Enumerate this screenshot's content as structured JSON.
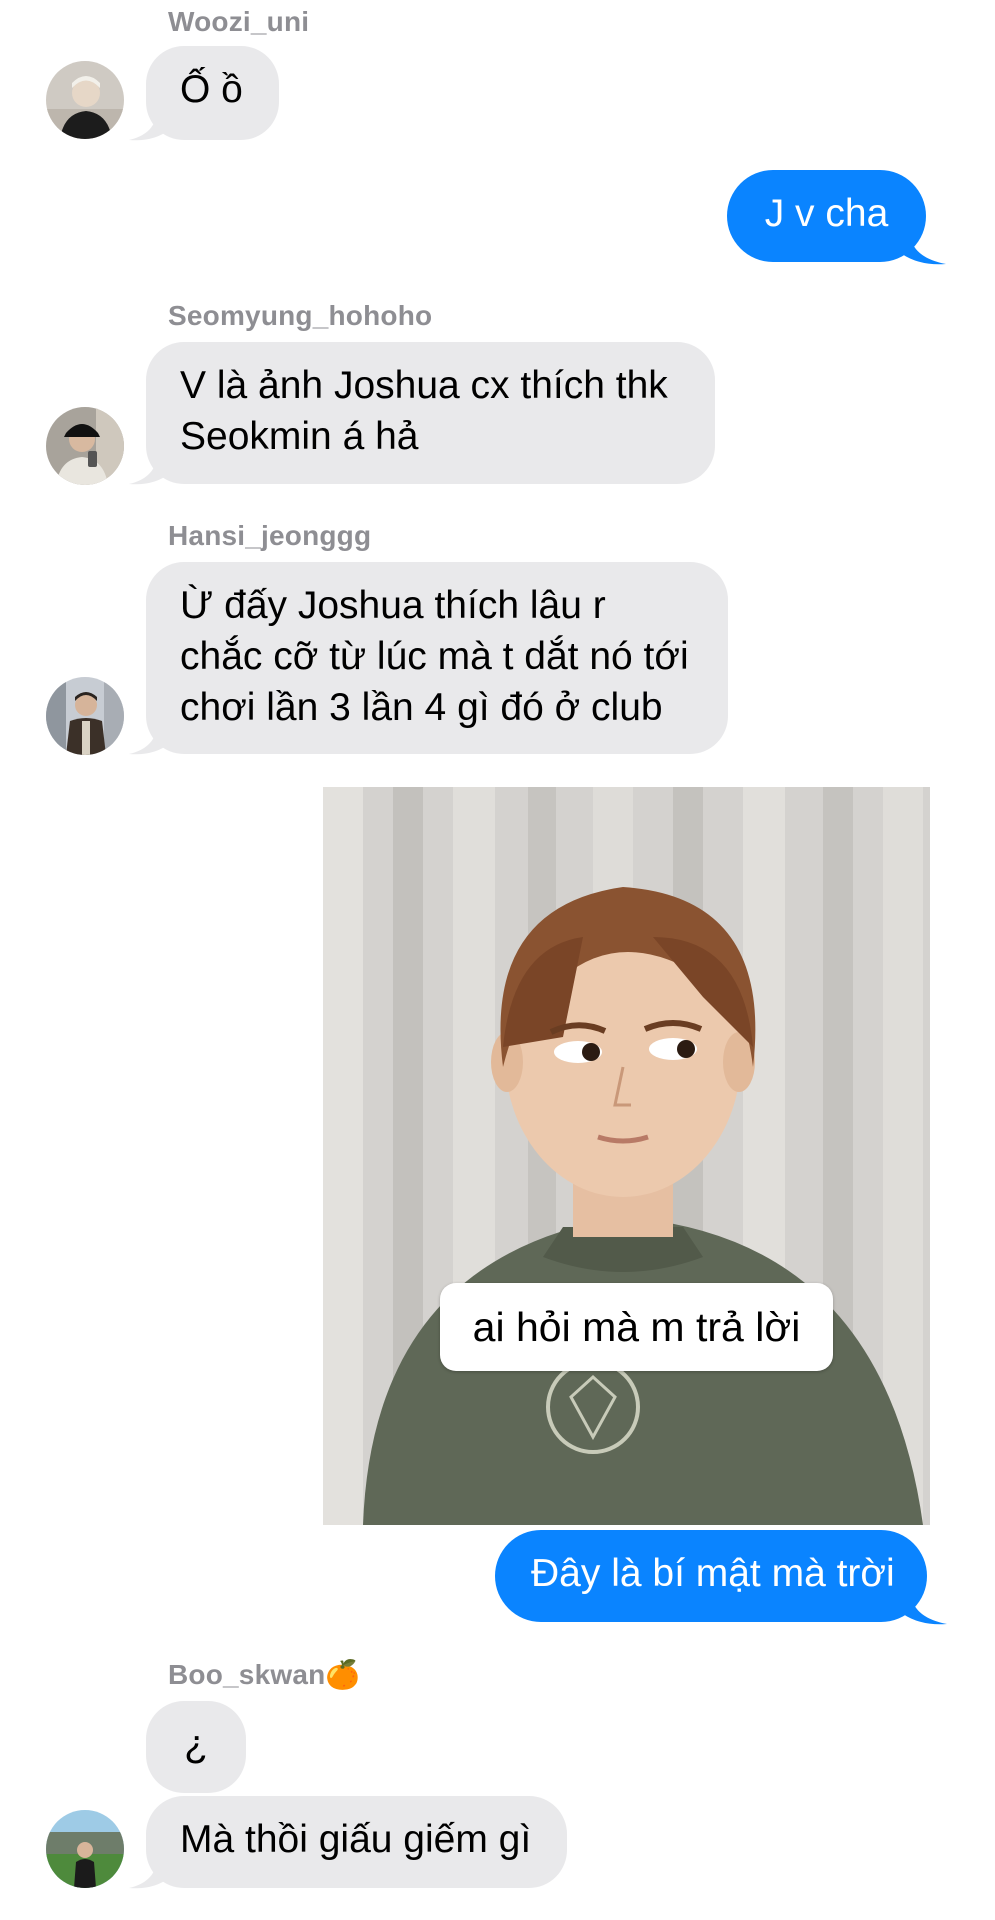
{
  "messages": {
    "woozi": {
      "sender": "Woozi_uni",
      "lines": [
        "Ố ồ"
      ]
    },
    "me_1": {
      "lines": [
        "J v cha"
      ]
    },
    "seomyung": {
      "sender": "Seomyung_hohoho",
      "lines": [
        "V là ảnh Joshua cx thích thk",
        "Seokmin á hả"
      ]
    },
    "hansi": {
      "sender": "Hansi_jeonggg",
      "lines": [
        "Ừ đấy Joshua thích lâu r",
        "chắc cỡ từ lúc mà t dắt nó tới",
        "chơi lần 3 lần 4 gì đó ở club"
      ]
    },
    "meme": {
      "caption": "ai hỏi mà m trả lời"
    },
    "me_2": {
      "lines": [
        "Đây là bí mật mà trời"
      ]
    },
    "boo": {
      "sender": "Boo_skwan🍊",
      "bubble_1": "¿",
      "bubble_2": "Mà thồi giấu giếm gì"
    }
  },
  "colors": {
    "incoming_bubble": "#e9e9eb",
    "outgoing_bubble": "#0a84ff",
    "sender_name": "#8e8e93"
  }
}
